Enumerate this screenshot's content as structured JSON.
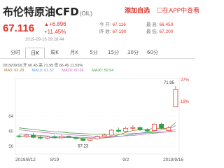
{
  "header": {
    "title": "布伦特原油CFD",
    "title_code": "(OIL)",
    "watch_label": "添加自选",
    "app_label": "在APP中查看"
  },
  "quote": {
    "price": "67.116",
    "change": "+6.896",
    "change_pct": "+11.45%",
    "timestamp": "2019-09-16 09:28:44",
    "stats": [
      {
        "label": "今 开:",
        "value": "67.116"
      },
      {
        "label": "最 高:",
        "value": "66.450"
      },
      {
        "label": "昨 收:",
        "value": "67.190"
      },
      {
        "label": "最 低:",
        "value": "67.200"
      }
    ]
  },
  "tabs": [
    {
      "label": "分时",
      "active": false
    },
    {
      "label": "日K",
      "active": true
    },
    {
      "label": "周K",
      "active": false
    },
    {
      "label": "月K",
      "active": false
    },
    {
      "label": "5分",
      "active": false
    },
    {
      "label": "15分",
      "active": false
    },
    {
      "label": "30分",
      "active": false
    },
    {
      "label": "60分",
      "active": false
    }
  ],
  "info": {
    "line1": "2019/09/16  开 66.45 高 71.95 低 66.45 11.53%",
    "ma5": "MA5: 62.28",
    "ma10": "MA10: 61.52",
    "ma20": "MA20: 60.56",
    "ma30": "MA30: 59.94"
  },
  "colors": {
    "up": "#e0352b",
    "down": "#2f9e44",
    "ma5": "#b07b2e",
    "ma10": "#6d9bd2",
    "ma20": "#c86dc2",
    "ma30": "#4fa34a"
  },
  "chart_data": {
    "type": "candlestick",
    "y_ticks": [
      "64",
      "60",
      "56"
    ],
    "right_ticks": [
      "27%",
      "19%"
    ],
    "x_labels": [
      "2019/8/12",
      "8/19",
      "9/2",
      "2019/9/16"
    ],
    "annotations": {
      "high": "71.95",
      "low": "57.23"
    },
    "ylim": [
      54,
      74
    ],
    "candles": [
      {
        "o": 58.8,
        "c": 58.6,
        "h": 59.2,
        "l": 58.2
      },
      {
        "o": 58.6,
        "c": 59.0,
        "h": 59.3,
        "l": 58.3
      },
      {
        "o": 59.0,
        "c": 58.4,
        "h": 59.6,
        "l": 58.1
      },
      {
        "o": 58.4,
        "c": 58.2,
        "h": 58.9,
        "l": 57.8
      },
      {
        "o": 58.2,
        "c": 58.5,
        "h": 58.8,
        "l": 57.9
      },
      {
        "o": 58.5,
        "c": 58.3,
        "h": 59.0,
        "l": 58.0
      },
      {
        "o": 58.3,
        "c": 58.7,
        "h": 59.1,
        "l": 58.1
      },
      {
        "o": 58.7,
        "c": 58.4,
        "h": 59.0,
        "l": 58.2
      },
      {
        "o": 58.4,
        "c": 58.1,
        "h": 58.6,
        "l": 57.6
      },
      {
        "o": 58.1,
        "c": 57.6,
        "h": 58.3,
        "l": 57.23
      },
      {
        "o": 57.6,
        "c": 58.0,
        "h": 58.3,
        "l": 57.4
      },
      {
        "o": 58.0,
        "c": 58.6,
        "h": 58.9,
        "l": 57.8
      },
      {
        "o": 58.6,
        "c": 59.0,
        "h": 59.4,
        "l": 58.4
      },
      {
        "o": 59.0,
        "c": 60.3,
        "h": 60.6,
        "l": 58.9
      },
      {
        "o": 60.3,
        "c": 60.0,
        "h": 61.0,
        "l": 59.7
      },
      {
        "o": 60.0,
        "c": 60.8,
        "h": 61.2,
        "l": 59.8
      },
      {
        "o": 60.8,
        "c": 61.0,
        "h": 61.6,
        "l": 60.4
      },
      {
        "o": 61.0,
        "c": 60.4,
        "h": 61.3,
        "l": 60.1
      },
      {
        "o": 60.4,
        "c": 60.1,
        "h": 60.8,
        "l": 59.8
      },
      {
        "o": 60.2,
        "c": 61.9,
        "h": 62.1,
        "l": 60.0
      },
      {
        "o": 61.9,
        "c": 60.8,
        "h": 62.3,
        "l": 60.5
      },
      {
        "o": 60.2,
        "c": 60.9,
        "h": 61.3,
        "l": 60.0
      },
      {
        "o": 66.45,
        "c": 71.1,
        "h": 71.95,
        "l": 66.45
      }
    ],
    "ma5": [
      58.7,
      58.6,
      58.5,
      58.5,
      58.4,
      58.3,
      58.3,
      58.4,
      58.3,
      58.1,
      58.0,
      58.1,
      58.3,
      58.6,
      59.1,
      59.7,
      60.2,
      60.4,
      60.5,
      60.8,
      60.8,
      60.7,
      62.28
    ],
    "ma10": [
      59.3,
      59.2,
      59.0,
      58.9,
      58.8,
      58.7,
      58.6,
      58.5,
      58.4,
      58.4,
      58.3,
      58.3,
      58.3,
      58.4,
      58.6,
      58.9,
      59.2,
      59.5,
      59.8,
      60.1,
      60.4,
      60.6,
      61.52
    ],
    "ma20": [
      60.4,
      60.2,
      60.0,
      59.8,
      59.6,
      59.4,
      59.3,
      59.1,
      59.0,
      58.9,
      58.8,
      58.7,
      58.7,
      58.7,
      58.7,
      58.8,
      58.9,
      59.1,
      59.3,
      59.5,
      59.7,
      59.9,
      60.56
    ],
    "ma30": [
      60.9,
      60.7,
      60.5,
      60.3,
      60.1,
      59.9,
      59.8,
      59.6,
      59.5,
      59.4,
      59.3,
      59.2,
      59.2,
      59.2,
      59.2,
      59.3,
      59.4,
      59.5,
      59.6,
      59.7,
      59.8,
      59.9,
      59.94
    ]
  }
}
